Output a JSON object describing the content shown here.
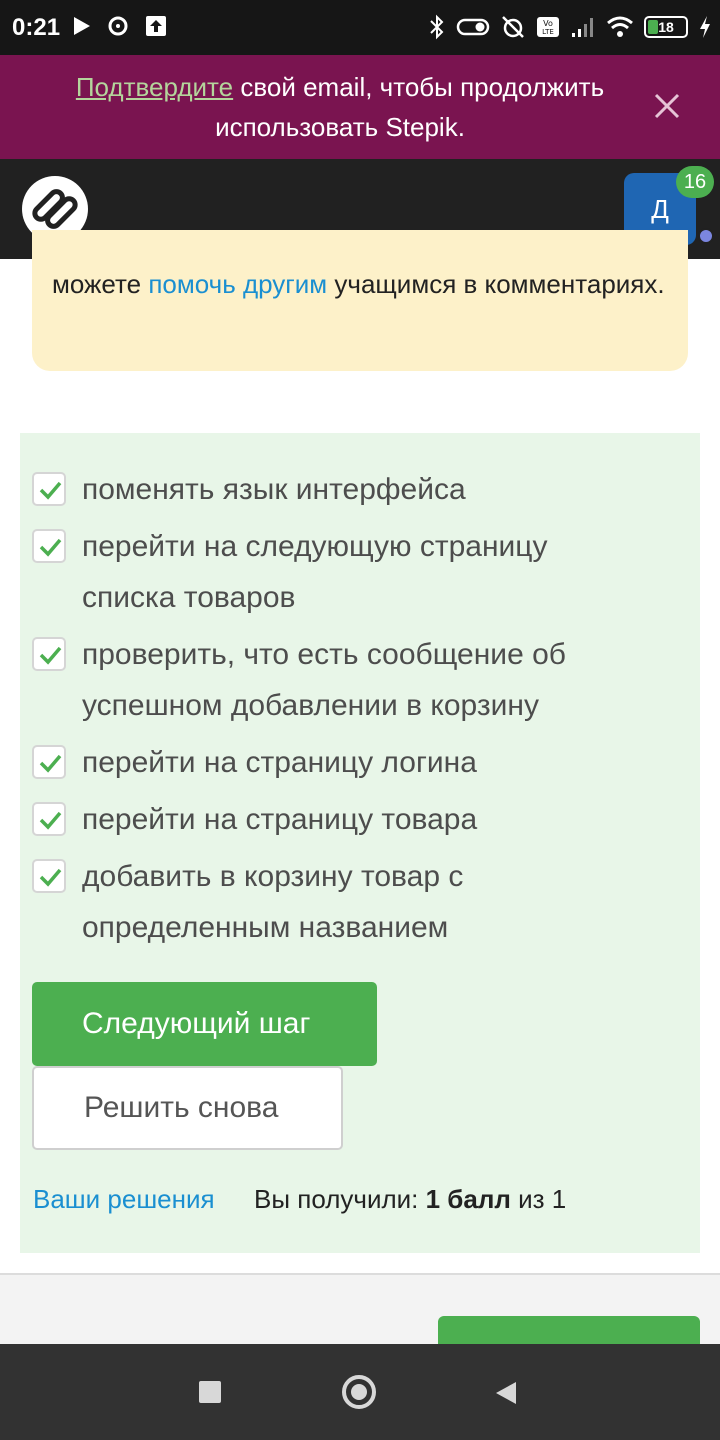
{
  "status_bar": {
    "time": "0:21",
    "battery": "18"
  },
  "notice": {
    "link_text": "Подтвердите",
    "rest_text": " свой email, чтобы продолжить использовать Stepik."
  },
  "header": {
    "avatar_letter": "Д",
    "notification_count": "16"
  },
  "info": {
    "prefix": "можете ",
    "link": "помочь другим",
    "suffix": " учащимся в комментариях."
  },
  "options": [
    {
      "label": "поменять язык интерфейса",
      "checked": true
    },
    {
      "label": "перейти на следующую страницу списка товаров",
      "checked": true
    },
    {
      "label": "проверить, что есть сообщение об успешном добавлении в корзину",
      "checked": true
    },
    {
      "label": "перейти на страницу логина",
      "checked": true
    },
    {
      "label": "перейти на страницу товара",
      "checked": true
    },
    {
      "label": "добавить в корзину товар с определенным названием",
      "checked": true
    }
  ],
  "actions": {
    "next_label": "Следующий шаг",
    "retry_label": "Решить снова"
  },
  "result": {
    "solutions_link": "Ваши решения",
    "score_prefix": "Вы получили: ",
    "score_value": "1 балл",
    "score_suffix": " из 1"
  },
  "colors": {
    "notice_bg": "#7a1450",
    "accent_green": "#4caf50",
    "link_blue": "#1a8fd1",
    "answer_bg": "#e8f6e8"
  }
}
